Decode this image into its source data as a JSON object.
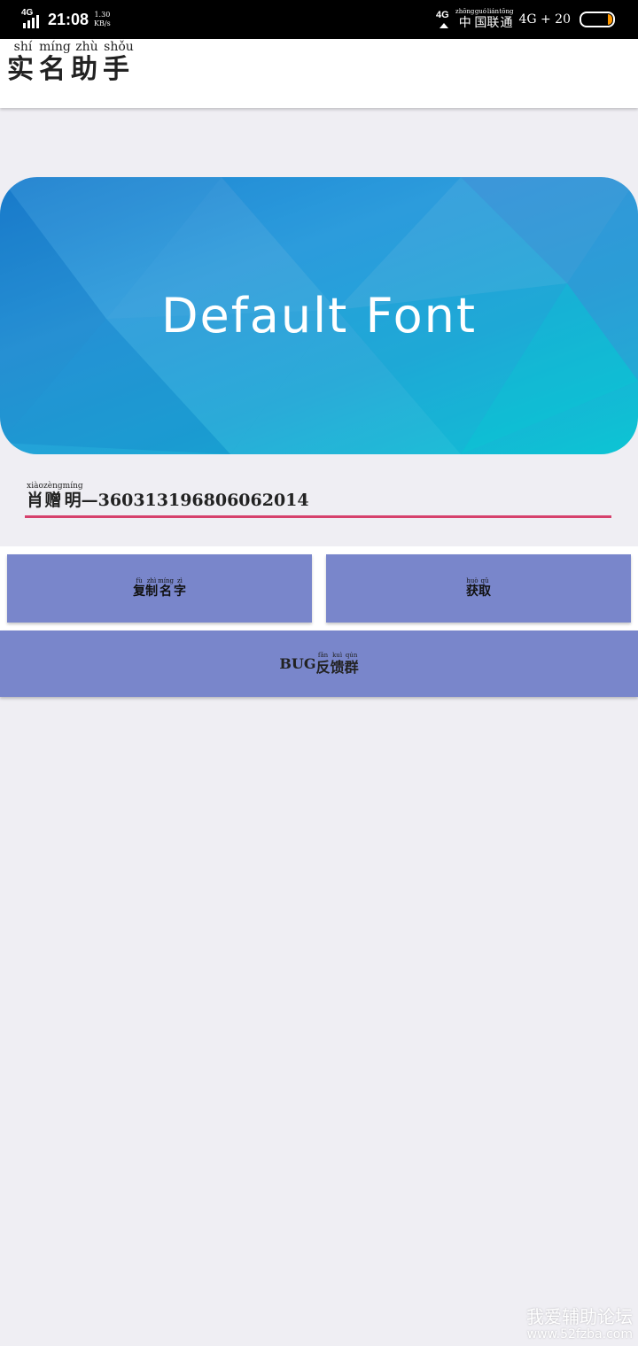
{
  "status_bar": {
    "network_left": "4G",
    "time": "21:08",
    "speed_value": "1.30",
    "speed_unit": "KB/s",
    "network_right": "4G",
    "carrier": [
      {
        "char": "中",
        "pinyin": "zhōng"
      },
      {
        "char": "国",
        "pinyin": "guó"
      },
      {
        "char": "联",
        "pinyin": "lián"
      },
      {
        "char": "通",
        "pinyin": "tōng"
      }
    ],
    "network_type": "4G + 20",
    "battery_icon": "battery-icon"
  },
  "app_bar": {
    "title": [
      {
        "char": "实",
        "pinyin": "shí"
      },
      {
        "char": "名",
        "pinyin": "míng"
      },
      {
        "char": "助",
        "pinyin": "zhù"
      },
      {
        "char": "手",
        "pinyin": "shǒu"
      }
    ]
  },
  "banner": {
    "text": "Default Font"
  },
  "name_field": {
    "name": [
      {
        "char": "肖",
        "pinyin": "xiào"
      },
      {
        "char": "赠",
        "pinyin": "zèng"
      },
      {
        "char": "明",
        "pinyin": "míng"
      }
    ],
    "suffix": "—360313196806062014",
    "underline_color": "#d6416c"
  },
  "buttons": {
    "copy": [
      {
        "char": "复",
        "pinyin": "fù"
      },
      {
        "char": "制",
        "pinyin": "zhì"
      },
      {
        "char": "名",
        "pinyin": "míng"
      },
      {
        "char": "字",
        "pinyin": "zì"
      }
    ],
    "fetch": [
      {
        "char": "获",
        "pinyin": "huò"
      },
      {
        "char": "取",
        "pinyin": "qǔ"
      }
    ],
    "feedback_prefix": "BUG",
    "feedback": [
      {
        "char": "反",
        "pinyin": "fǎn"
      },
      {
        "char": "馈",
        "pinyin": "kuì"
      },
      {
        "char": "群",
        "pinyin": "qún"
      }
    ],
    "color": "#7986cb"
  },
  "watermark": {
    "line1": "我爱辅助论坛",
    "line2": "www.52fzba.com"
  }
}
